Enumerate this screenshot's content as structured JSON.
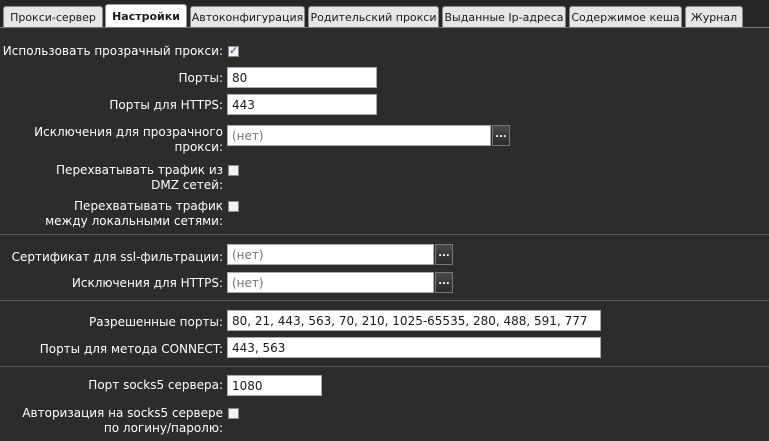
{
  "tabs": [
    {
      "label": "Прокси-сервер",
      "active": false
    },
    {
      "label": "Настройки",
      "active": true
    },
    {
      "label": "Автоконфигурация",
      "active": false
    },
    {
      "label": "Родительский прокси",
      "active": false
    },
    {
      "label": "Выданные Ip-адреса",
      "active": false
    },
    {
      "label": "Содержимое кеша",
      "active": false
    },
    {
      "label": "Журнал",
      "active": false
    }
  ],
  "settings": {
    "transparent_proxy": {
      "label": "Использовать прозрачный прокси:",
      "checked": true
    },
    "ports": {
      "label": "Порты:",
      "value": "80"
    },
    "https_ports": {
      "label": "Порты для HTTPS:",
      "value": "443"
    },
    "transparent_exclusions": {
      "label": "Исключения для прозрачного прокси:",
      "placeholder": "(нет)"
    },
    "intercept_dmz": {
      "label": "Перехватывать трафик из DMZ сетей:",
      "checked": false
    },
    "intercept_local": {
      "label": "Перехватывать трафик между локальными сетями:",
      "checked": false
    },
    "ssl_certificate": {
      "label": "Сертификат для ssl-фильтрации:",
      "placeholder": "(нет)"
    },
    "https_exclusions": {
      "label": "Исключения для HTTPS:",
      "placeholder": "(нет)"
    },
    "allowed_ports": {
      "label": "Разрешенные порты:",
      "value": "80, 21, 443, 563, 70, 210, 1025-65535, 280, 488, 591, 777"
    },
    "connect_ports": {
      "label": "Порты для метода CONNECT:",
      "value": "443, 563"
    },
    "socks5_port": {
      "label": "Порт socks5 сервера:",
      "value": "1080"
    },
    "socks5_auth": {
      "label": "Авторизация на socks5 сервере по логину/паролю:",
      "checked": false
    }
  },
  "browse_button_label": "..."
}
